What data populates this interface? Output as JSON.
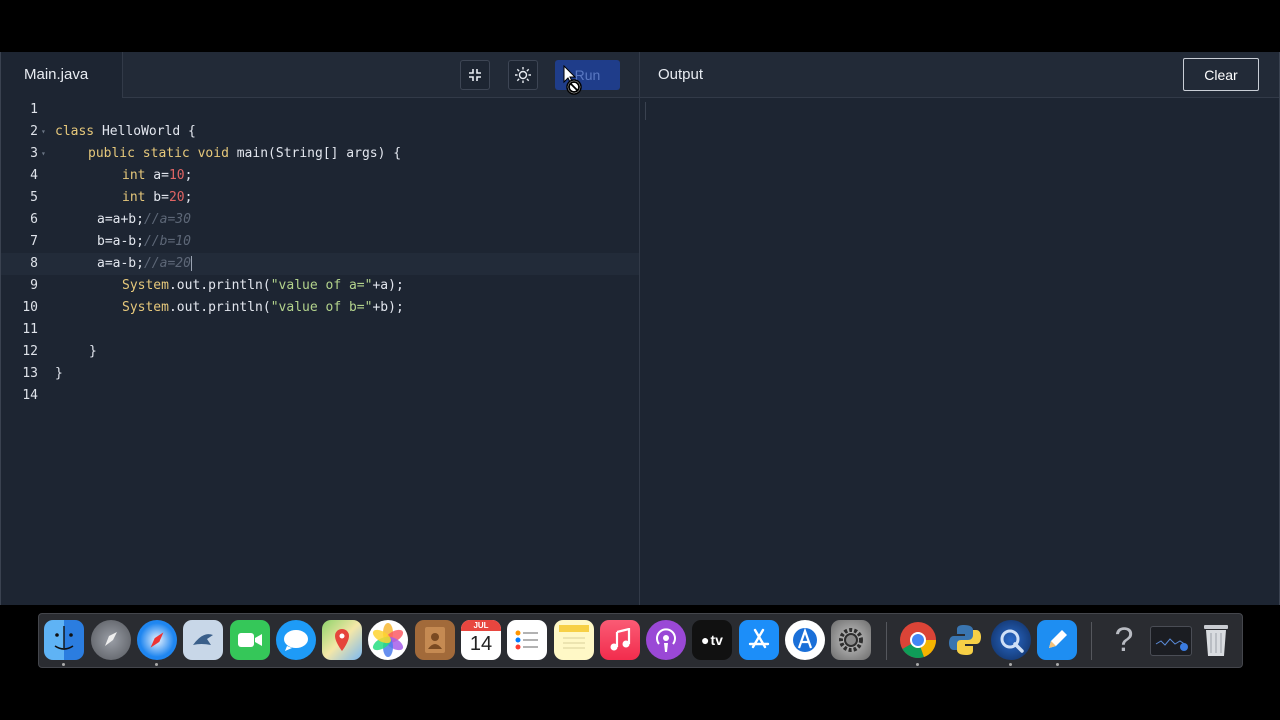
{
  "editor": {
    "file_tab": "Main.java",
    "run_label": "Run",
    "lines": [
      {
        "n": "1",
        "indent": 0,
        "html": ""
      },
      {
        "n": "2",
        "indent": 0,
        "fold": true,
        "html": "<span class=\"kw\">class</span> HelloWorld {"
      },
      {
        "n": "3",
        "indent": 33,
        "fold": true,
        "html": "<span class=\"kw\">public</span> <span class=\"kw\">static</span> <span class=\"kw\">void</span> main(String[] args) {"
      },
      {
        "n": "4",
        "indent": 67,
        "html": "<span class=\"kw\">int</span> a=<span class=\"num\">10</span>;"
      },
      {
        "n": "5",
        "indent": 67,
        "html": "<span class=\"kw\">int</span> b=<span class=\"num\">20</span>;"
      },
      {
        "n": "6",
        "indent": 42,
        "html": "a=a+b;<span class=\"cm\">//a=30</span>"
      },
      {
        "n": "7",
        "indent": 42,
        "html": "b=a-b;<span class=\"cm\">//b=10</span>"
      },
      {
        "n": "8",
        "indent": 42,
        "active": true,
        "html": "a=a-b;<span class=\"cm\">//a=20</span><span class=\"caret\"></span>"
      },
      {
        "n": "9",
        "indent": 67,
        "html": "<span class=\"kw\">System</span>.out.println(<span class=\"str\">\"value of a=\"</span>+a);"
      },
      {
        "n": "10",
        "indent": 67,
        "html": "<span class=\"kw\">System</span>.out.println(<span class=\"str\">\"value of b=\"</span>+b);"
      },
      {
        "n": "11",
        "indent": 0,
        "html": ""
      },
      {
        "n": "12",
        "indent": 34,
        "html": "}"
      },
      {
        "n": "13",
        "indent": 0,
        "html": "}"
      },
      {
        "n": "14",
        "indent": 0,
        "html": ""
      }
    ]
  },
  "output": {
    "title": "Output",
    "clear_label": "Clear",
    "content": ""
  },
  "dock": {
    "calendar_month": "JUL",
    "calendar_day": "14",
    "tv_label": "tv",
    "help_label": "?"
  }
}
